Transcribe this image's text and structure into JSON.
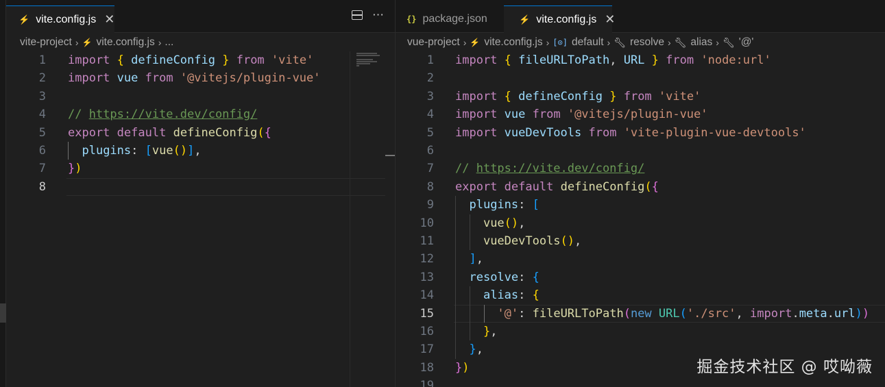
{
  "left": {
    "tab": {
      "label": "vite.config.js",
      "icon": "lightning-icon"
    },
    "breadcrumb": [
      "vite-project",
      "vite.config.js",
      "..."
    ],
    "active_line": 8,
    "lines": [
      {
        "n": "1",
        "t": [
          [
            "import",
            "kwc"
          ],
          [
            " ",
            ""
          ],
          [
            "{",
            "b1"
          ],
          [
            " defineConfig ",
            "var"
          ],
          [
            "}",
            "b1"
          ],
          [
            " ",
            ""
          ],
          [
            "from",
            "kwc"
          ],
          [
            " ",
            ""
          ],
          [
            "'vite'",
            "str"
          ]
        ]
      },
      {
        "n": "2",
        "t": [
          [
            "import",
            "kwc"
          ],
          [
            " vue ",
            "var"
          ],
          [
            "from",
            "kwc"
          ],
          [
            " ",
            ""
          ],
          [
            "'@vitejs/plugin-vue'",
            "str"
          ]
        ]
      },
      {
        "n": "3",
        "t": []
      },
      {
        "n": "4",
        "t": [
          [
            "// ",
            "cm"
          ],
          [
            "https://vite.dev/config/",
            "link"
          ]
        ]
      },
      {
        "n": "5",
        "t": [
          [
            "export",
            "kwc"
          ],
          [
            " ",
            ""
          ],
          [
            "default",
            "kwc"
          ],
          [
            " ",
            ""
          ],
          [
            "defineConfig",
            "fn"
          ],
          [
            "(",
            "b1"
          ],
          [
            "{",
            "b2"
          ]
        ]
      },
      {
        "n": "6",
        "t": [
          [
            "  ",
            ""
          ],
          [
            "plugins",
            "var"
          ],
          [
            ": ",
            "pun"
          ],
          [
            "[",
            "b3"
          ],
          [
            "vue",
            "fn"
          ],
          [
            "()",
            "b1"
          ],
          [
            "]",
            "b3"
          ],
          [
            ",",
            "pun"
          ]
        ]
      },
      {
        "n": "7",
        "t": [
          [
            "}",
            "b2"
          ],
          [
            ")",
            "b1"
          ]
        ]
      },
      {
        "n": "8",
        "t": []
      }
    ]
  },
  "right": {
    "tabs": [
      {
        "label": "package.json",
        "icon": "json-braces-icon"
      },
      {
        "label": "vite.config.js",
        "icon": "lightning-icon"
      }
    ],
    "breadcrumb": [
      "vue-project",
      "vite.config.js",
      "default",
      "resolve",
      "alias",
      "'@'"
    ],
    "active_line": 15,
    "lines": [
      {
        "n": "1",
        "t": [
          [
            "import",
            "kwc"
          ],
          [
            " ",
            ""
          ],
          [
            "{",
            "b1"
          ],
          [
            " fileURLToPath",
            "var"
          ],
          [
            ", ",
            "pun"
          ],
          [
            "URL ",
            "var"
          ],
          [
            "}",
            "b1"
          ],
          [
            " ",
            ""
          ],
          [
            "from",
            "kwc"
          ],
          [
            " ",
            ""
          ],
          [
            "'node:url'",
            "str"
          ]
        ]
      },
      {
        "n": "2",
        "t": []
      },
      {
        "n": "3",
        "t": [
          [
            "import",
            "kwc"
          ],
          [
            " ",
            ""
          ],
          [
            "{",
            "b1"
          ],
          [
            " defineConfig ",
            "var"
          ],
          [
            "}",
            "b1"
          ],
          [
            " ",
            ""
          ],
          [
            "from",
            "kwc"
          ],
          [
            " ",
            ""
          ],
          [
            "'vite'",
            "str"
          ]
        ]
      },
      {
        "n": "4",
        "t": [
          [
            "import",
            "kwc"
          ],
          [
            " vue ",
            "var"
          ],
          [
            "from",
            "kwc"
          ],
          [
            " ",
            ""
          ],
          [
            "'@vitejs/plugin-vue'",
            "str"
          ]
        ]
      },
      {
        "n": "5",
        "t": [
          [
            "import",
            "kwc"
          ],
          [
            " vueDevTools ",
            "var"
          ],
          [
            "from",
            "kwc"
          ],
          [
            " ",
            ""
          ],
          [
            "'vite-plugin-vue-devtools'",
            "str"
          ]
        ]
      },
      {
        "n": "6",
        "t": []
      },
      {
        "n": "7",
        "t": [
          [
            "// ",
            "cm"
          ],
          [
            "https://vite.dev/config/",
            "link"
          ]
        ]
      },
      {
        "n": "8",
        "t": [
          [
            "export",
            "kwc"
          ],
          [
            " ",
            ""
          ],
          [
            "default",
            "kwc"
          ],
          [
            " ",
            ""
          ],
          [
            "defineConfig",
            "fn"
          ],
          [
            "(",
            "b1"
          ],
          [
            "{",
            "b2"
          ]
        ]
      },
      {
        "n": "9",
        "t": [
          [
            "  ",
            ""
          ],
          [
            "plugins",
            "var"
          ],
          [
            ": ",
            "pun"
          ],
          [
            "[",
            "b3"
          ]
        ]
      },
      {
        "n": "10",
        "t": [
          [
            "    ",
            ""
          ],
          [
            "vue",
            "fn"
          ],
          [
            "()",
            "b1"
          ],
          [
            ",",
            "pun"
          ]
        ]
      },
      {
        "n": "11",
        "t": [
          [
            "    ",
            ""
          ],
          [
            "vueDevTools",
            "fn"
          ],
          [
            "()",
            "b1"
          ],
          [
            ",",
            "pun"
          ]
        ]
      },
      {
        "n": "12",
        "t": [
          [
            "  ",
            ""
          ],
          [
            "]",
            "b3"
          ],
          [
            ",",
            "pun"
          ]
        ]
      },
      {
        "n": "13",
        "t": [
          [
            "  ",
            ""
          ],
          [
            "resolve",
            "var"
          ],
          [
            ": ",
            "pun"
          ],
          [
            "{",
            "b3"
          ]
        ]
      },
      {
        "n": "14",
        "t": [
          [
            "    ",
            ""
          ],
          [
            "alias",
            "var"
          ],
          [
            ": ",
            "pun"
          ],
          [
            "{",
            "b1"
          ]
        ]
      },
      {
        "n": "15",
        "t": [
          [
            "      ",
            ""
          ],
          [
            "'@'",
            "str"
          ],
          [
            ": ",
            "pun"
          ],
          [
            "fileURLToPath",
            "fn"
          ],
          [
            "(",
            "b2"
          ],
          [
            "new",
            "kw"
          ],
          [
            " ",
            ""
          ],
          [
            "URL",
            "typ"
          ],
          [
            "(",
            "b3"
          ],
          [
            "'./src'",
            "str"
          ],
          [
            ", ",
            "pun"
          ],
          [
            "import",
            "kwc"
          ],
          [
            ".",
            "pun"
          ],
          [
            "meta",
            "var"
          ],
          [
            ".",
            "pun"
          ],
          [
            "url",
            "var"
          ],
          [
            ")",
            "b3"
          ],
          [
            ")",
            "b2"
          ]
        ]
      },
      {
        "n": "16",
        "t": [
          [
            "    ",
            ""
          ],
          [
            "}",
            "b1"
          ],
          [
            ",",
            "pun"
          ]
        ]
      },
      {
        "n": "17",
        "t": [
          [
            "  ",
            ""
          ],
          [
            "}",
            "b3"
          ],
          [
            ",",
            "pun"
          ]
        ]
      },
      {
        "n": "18",
        "t": [
          [
            "}",
            "b2"
          ],
          [
            ")",
            "b1"
          ]
        ]
      },
      {
        "n": "19",
        "t": []
      }
    ]
  },
  "watermark": "掘金技术社区 @ 哎呦薇"
}
